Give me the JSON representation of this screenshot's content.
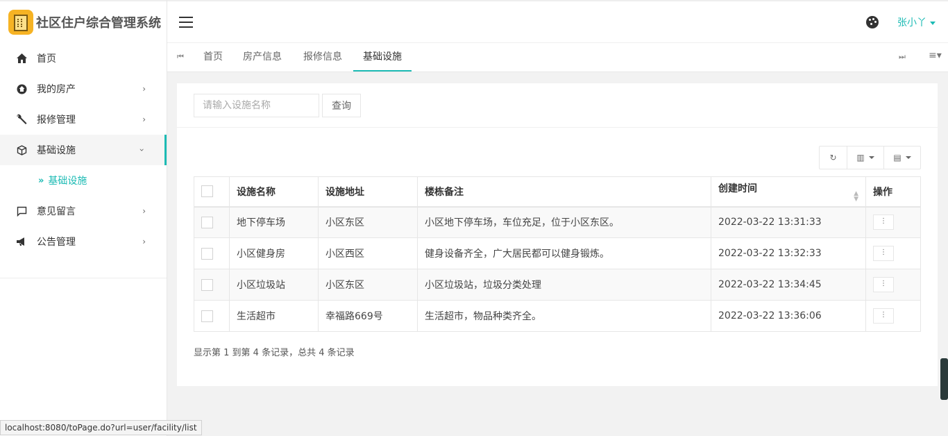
{
  "app": {
    "title": "社区住户综合管理系统",
    "accent": "#1cbbb4"
  },
  "sidebar": {
    "items": [
      {
        "label": "首页",
        "icon": "home-icon"
      },
      {
        "label": "我的房产",
        "icon": "house-icon"
      },
      {
        "label": "报修管理",
        "icon": "wrench-icon"
      },
      {
        "label": "基础设施",
        "icon": "cube-icon"
      },
      {
        "label": "意见留言",
        "icon": "message-icon"
      },
      {
        "label": "公告管理",
        "icon": "megaphone-icon"
      }
    ],
    "submenu_label": "基础设施"
  },
  "header": {
    "user_name": "张小丫"
  },
  "tabs": [
    {
      "label": "首页"
    },
    {
      "label": "房产信息"
    },
    {
      "label": "报修信息"
    },
    {
      "label": "基础设施"
    }
  ],
  "search": {
    "placeholder": "请输入设施名称",
    "button_label": "查询"
  },
  "table": {
    "headers": [
      "设施名称",
      "设施地址",
      "楼栋备注",
      "创建时间",
      "操作"
    ],
    "rows": [
      {
        "name": "地下停车场",
        "address": "小区东区",
        "note": "小区地下停车场，车位充足，位于小区东区。",
        "created": "2022-03-22 13:31:33"
      },
      {
        "name": "小区健身房",
        "address": "小区西区",
        "note": "健身设备齐全，广大居民都可以健身锻炼。",
        "created": "2022-03-22 13:32:33"
      },
      {
        "name": "小区垃圾站",
        "address": "小区东区",
        "note": "小区垃圾站，垃圾分类处理",
        "created": "2022-03-22 13:34:45"
      },
      {
        "name": "生活超市",
        "address": "幸福路669号",
        "note": "生活超市，物品种类齐全。",
        "created": "2022-03-22 13:36:06"
      }
    ]
  },
  "summary": "显示第 1 到第 4 条记录，总共 4 条记录",
  "statusbar": "localhost:8080/toPage.do?url=user/facility/list"
}
